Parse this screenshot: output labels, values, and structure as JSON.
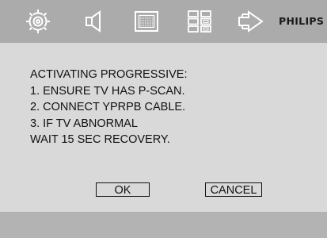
{
  "toolbar": {
    "icons": [
      "gear-icon",
      "speaker-icon",
      "display-icon",
      "grid-icon",
      "arrow-right-icon"
    ],
    "brand": "PHILIPS",
    "background_color": "#ababab"
  },
  "dialog": {
    "lines": [
      "ACTIVATING PROGRESSIVE:",
      "1. ENSURE TV HAS P-SCAN.",
      "2. CONNECT YPRPB CABLE.",
      "3. IF TV ABNORMAL",
      "WAIT 15 SEC RECOVERY."
    ],
    "ok_label": "OK",
    "cancel_label": "CANCEL",
    "background_color": "#d9d9d9"
  },
  "bottom_bar": {
    "background_color": "#b3b3b3"
  }
}
